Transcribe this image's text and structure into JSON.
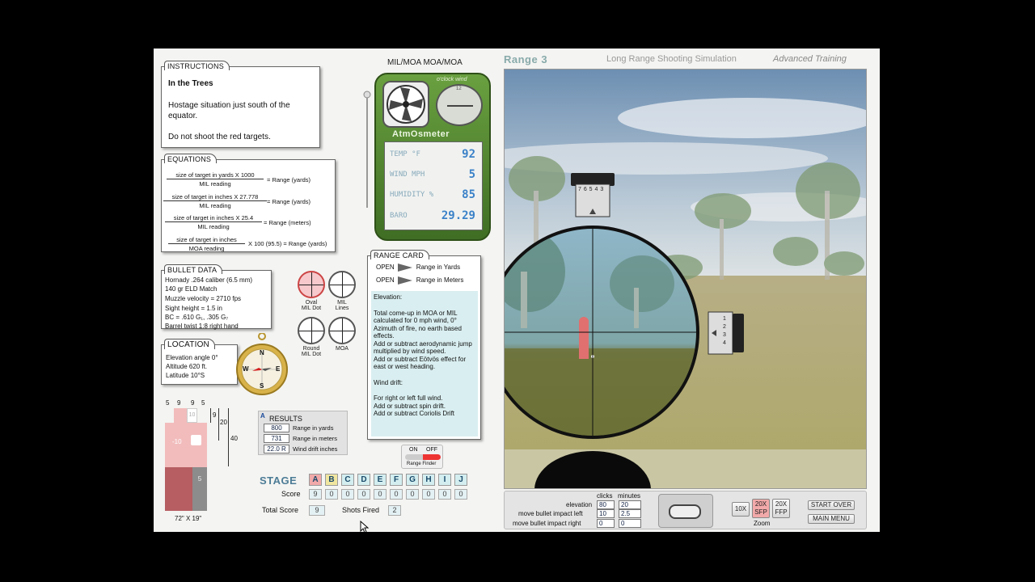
{
  "header": {
    "app_title": "Range 3",
    "subtitle": "Long Range Shooting Simulation",
    "mode": "Advanced Training",
    "mil_moa": "MIL/MOA MOA/MOA"
  },
  "instructions": {
    "tab": "INSTRUCTIONS",
    "title": "In the Trees",
    "line1": "Hostage situation just south of the equator.",
    "line2": "Do not shoot the red targets."
  },
  "equations": {
    "tab": "EQUATIONS",
    "items": [
      {
        "num": "size of target in yards X 1000",
        "den": "MIL reading",
        "result": "= Range (yards)"
      },
      {
        "num": "size of target in inches X 27.778",
        "den": "MIL reading",
        "result": "= Range (yards)"
      },
      {
        "num": "size of target in inches X 25.4",
        "den": "MIL reading",
        "result": "= Range (meters)"
      },
      {
        "num": "size of target in inches",
        "den": "MOA reading",
        "result": "X 100 (95.5) = Range (yards)"
      }
    ]
  },
  "bullet_data": {
    "tab": "BULLET DATA",
    "lines": [
      "Hornady .264 caliber (6.5 mm)",
      "140 gr ELD Match",
      "Muzzle velocity = 2710 fps",
      "Sight height = 1.5 in",
      "BC = .610 G₁, .305 G₇",
      "Barrel twist 1:8 right hand"
    ]
  },
  "reticles": [
    {
      "label1": "Oval",
      "label2": "MIL Dot"
    },
    {
      "label1": "MIL",
      "label2": "Lines"
    },
    {
      "label1": "Round",
      "label2": "MIL Dot"
    },
    {
      "label1": "MOA",
      "label2": ""
    }
  ],
  "location": {
    "tab": "LOCATION",
    "lines": [
      "Elevation angle 0°",
      "Altitude 620 ft.",
      "Latitude 10°S"
    ]
  },
  "compass": {
    "n": "N",
    "s": "S",
    "e": "E",
    "w": "W"
  },
  "atmosmeter": {
    "brand": "AtmOsmeter",
    "wind_label": "o'clock wind",
    "clock_12": "12",
    "temp_label": "TEMP °F",
    "temp": "92",
    "wind_label2": "WIND MPH",
    "wind": "5",
    "humidity_label": "HUMIDITY %",
    "humidity": "85",
    "baro_label": "BARO",
    "baro": "29.29"
  },
  "range_card": {
    "tab": "RANGE CARD",
    "open1": "OPEN",
    "yards_label": "Range in Yards",
    "open2": "OPEN",
    "meters_label": "Range in Meters",
    "elev_title": "Elevation:",
    "elev_text": "Total come-up in MOA or MIL calculated for 0 mph wind, 0° Azimuth of fire, no earth based effects.",
    "elev_text2": "Add or subtract aerodynamic jump multiplied by wind speed.",
    "elev_text3": "Add or subtract Eötvös effect for east or west heading.",
    "drift_title": "Wind drift:",
    "drift_text": "For right or left full wind.",
    "drift_text2": "Add or subtract spin drift.",
    "drift_text3": "Add or subtract Coriolis Drift"
  },
  "rangefinder": {
    "on": "ON",
    "off": "OFF",
    "label": "Range Finder"
  },
  "target_diagram": {
    "top_nums": [
      "5",
      "9",
      "9",
      "5"
    ],
    "ring_10": "10",
    "ring_neg10": "-10",
    "ring_5": "5",
    "dim_9": "9",
    "dim_20": "20",
    "dim_40": "40",
    "size": "72\" X 19\""
  },
  "results": {
    "badge": "A",
    "title": "RESULTS",
    "yards": "800",
    "yards_label": "Range in yards",
    "meters": "731",
    "meters_label": "Range in meters",
    "drift": "22.0 R",
    "drift_label": "Wind drift inches"
  },
  "stage": {
    "label": "STAGE",
    "letters": [
      "A",
      "B",
      "C",
      "D",
      "E",
      "F",
      "G",
      "H",
      "I",
      "J"
    ],
    "score_label": "Score",
    "scores": [
      "9",
      "0",
      "0",
      "0",
      "0",
      "0",
      "0",
      "0",
      "0",
      "0"
    ],
    "total_label": "Total Score",
    "total": "9",
    "shots_label": "Shots Fired",
    "shots": "2"
  },
  "scope_controls": {
    "col_clicks": "clicks",
    "col_minutes": "minutes",
    "elevation_label": "elevation",
    "elev_clicks": "80",
    "elev_minutes": "20",
    "left_label": "move bullet impact left",
    "left_clicks": "10",
    "left_minutes": "2.5",
    "right_label": "move bullet impact right",
    "right_clicks": "0",
    "right_minutes": "0"
  },
  "zoom": {
    "z10": "10X",
    "z20sfp_a": "20X",
    "z20sfp_b": "SFP",
    "z20ffp_a": "20X",
    "z20ffp_b": "FFP",
    "label": "Zoom"
  },
  "buttons": {
    "start_over": "START OVER",
    "main_menu": "MAIN MENU"
  },
  "turret": {
    "top_nums": "7 6 5 4 3",
    "side_nums": "1 2 3 4"
  },
  "colors": {
    "accent_green": "#4a7a2a",
    "lcd_blue": "#3b82c8",
    "target_red": "#e07070",
    "stage_header": "#4c7c96"
  }
}
